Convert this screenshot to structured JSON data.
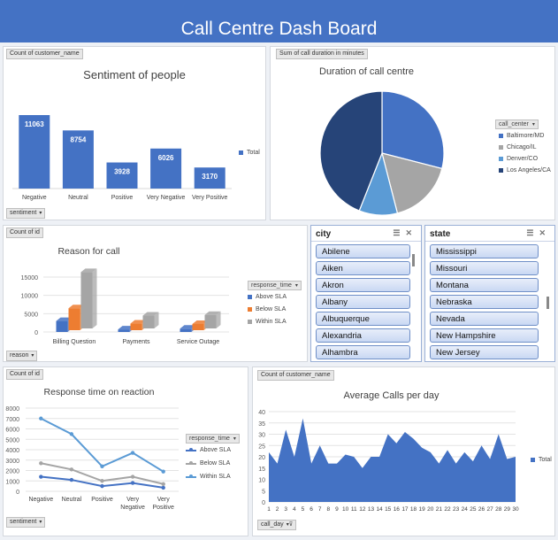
{
  "dashboard": {
    "title": "Call Centre Dash Board"
  },
  "sentiment_chart": {
    "field_button": "Count of customer_name",
    "axis_field": "sentiment",
    "legend_label": "Total",
    "chart_data": {
      "type": "bar",
      "title": "Sentiment of people",
      "categories": [
        "Negative",
        "Neutral",
        "Positive",
        "Very Negative",
        "Very Positive"
      ],
      "series": [
        {
          "name": "Total",
          "values": [
            11063,
            8754,
            3928,
            6026,
            3170
          ]
        }
      ],
      "ylim": [
        0,
        13000
      ],
      "color": "#4472c4",
      "data_labels": true
    }
  },
  "duration_chart": {
    "field_button": "Sum of call duration in minutes",
    "legend_header": "call_center",
    "chart_data": {
      "type": "pie",
      "title": "Duration of call centre",
      "slices": [
        {
          "label": "Baltimore/MD",
          "value": 29,
          "color": "#4472c4"
        },
        {
          "label": "Chicago/IL",
          "value": 17,
          "color": "#a5a5a5"
        },
        {
          "label": "Denver/CO",
          "value": 10,
          "color": "#5b9bd5"
        },
        {
          "label": "Los Angeles/CA",
          "value": 44,
          "color": "#264478"
        }
      ]
    }
  },
  "reason_chart": {
    "field_button": "Count of id",
    "axis_field": "reason",
    "legend_header": "response_time",
    "chart_data": {
      "type": "bar",
      "title": "Reason for call",
      "categories": [
        "Billing Question",
        "Payments",
        "Service Outage"
      ],
      "series": [
        {
          "name": "Above SLA",
          "values": [
            3000,
            700,
            900
          ],
          "color": "#4472c4"
        },
        {
          "name": "Below SLA",
          "values": [
            6000,
            1800,
            1700
          ],
          "color": "#ed7d31"
        },
        {
          "name": "Within SLA",
          "values": [
            15400,
            3500,
            3700
          ],
          "color": "#a5a5a5"
        }
      ],
      "ylim": [
        0,
        15000
      ],
      "yticks": [
        0,
        5000,
        10000,
        15000
      ]
    }
  },
  "response_chart": {
    "field_button": "Count of id",
    "axis_field": "sentiment",
    "legend_header": "response_time",
    "chart_data": {
      "type": "line",
      "title": "Response time on reaction",
      "categories": [
        "Negative",
        "Neutral",
        "Positive",
        "Very\nNegative",
        "Very\nPositive"
      ],
      "series": [
        {
          "name": "Above SLA",
          "values": [
            1400,
            1100,
            500,
            800,
            350
          ],
          "color": "#4472c4"
        },
        {
          "name": "Below SLA",
          "values": [
            2700,
            2100,
            1000,
            1400,
            700
          ],
          "color": "#a5a5a5"
        },
        {
          "name": "Within SLA",
          "values": [
            7000,
            5500,
            2400,
            3700,
            1900
          ],
          "color": "#5b9bd5"
        }
      ],
      "ylim": [
        0,
        8000
      ],
      "yticks": [
        0,
        1000,
        2000,
        3000,
        4000,
        5000,
        6000,
        7000,
        8000
      ]
    }
  },
  "calls_chart": {
    "field_button": "Count of customer_name",
    "axis_field": "call_day",
    "legend_label": "Total",
    "chart_data": {
      "type": "area",
      "title": "Average Calls per day",
      "x": [
        1,
        2,
        3,
        4,
        5,
        6,
        7,
        8,
        9,
        10,
        11,
        12,
        13,
        14,
        15,
        16,
        17,
        18,
        19,
        20,
        21,
        22,
        23,
        24,
        25,
        26,
        27,
        28,
        29,
        30
      ],
      "series": [
        {
          "name": "Total",
          "values": [
            22,
            17,
            32,
            20,
            37,
            17,
            25,
            17,
            17,
            21,
            20,
            15,
            20,
            20,
            30,
            26,
            31,
            28,
            24,
            22,
            17,
            23,
            17,
            22,
            18,
            25,
            19,
            30,
            19,
            20
          ]
        }
      ],
      "ylim": [
        0,
        40
      ],
      "yticks": [
        0,
        5,
        10,
        15,
        20,
        25,
        30,
        35,
        40
      ],
      "color": "#4472c4"
    }
  },
  "city_slicer": {
    "header": "city",
    "items": [
      "Abilene",
      "Aiken",
      "Akron",
      "Albany",
      "Albuquerque",
      "Alexandria",
      "Alhambra"
    ]
  },
  "state_slicer": {
    "header": "state",
    "items": [
      "Mississippi",
      "Missouri",
      "Montana",
      "Nebraska",
      "Nevada",
      "New Hampshire",
      "New Jersey"
    ]
  }
}
